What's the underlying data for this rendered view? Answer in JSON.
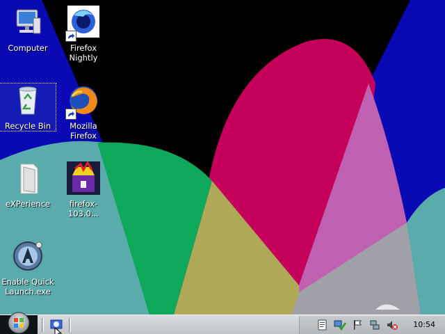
{
  "desktop": {
    "icons": [
      {
        "label": "Computer",
        "icon": "computer-icon"
      },
      {
        "label": "Firefox\nNightly",
        "icon": "firefox-nightly-icon"
      },
      {
        "label": "Recycle Bin",
        "icon": "recycle-bin-icon"
      },
      {
        "label": "Mozilla Firefox",
        "icon": "firefox-icon"
      },
      {
        "label": "eXPerience",
        "icon": "folder-icon"
      },
      {
        "label": "firefox-103.0...",
        "icon": "installer-icon"
      },
      {
        "label": "Enable Quick\nLaunch.exe",
        "icon": "quick-launch-icon"
      }
    ],
    "selected_icon": "Recycle Bin"
  },
  "taskbar": {
    "start_icon": "windows-orb-icon",
    "quick_launch": [
      {
        "icon": "show-desktop-icon"
      }
    ],
    "tray_icons": [
      "document-icon",
      "network-check-icon",
      "flag-icon",
      "network-icon",
      "volume-muted-icon"
    ],
    "clock": "10:54"
  },
  "colors": {
    "wallpaper_black": "#000000",
    "wallpaper_blue": "#0a0ab4",
    "wallpaper_teal": "#5aabab",
    "wallpaper_green": "#0ea85a",
    "wallpaper_olive": "#b0aa58",
    "wallpaper_crimson": "#c4005a",
    "wallpaper_purple": "#c060b0",
    "wallpaper_gray": "#a0a0a8",
    "taskbar": "#cfd3d5"
  }
}
